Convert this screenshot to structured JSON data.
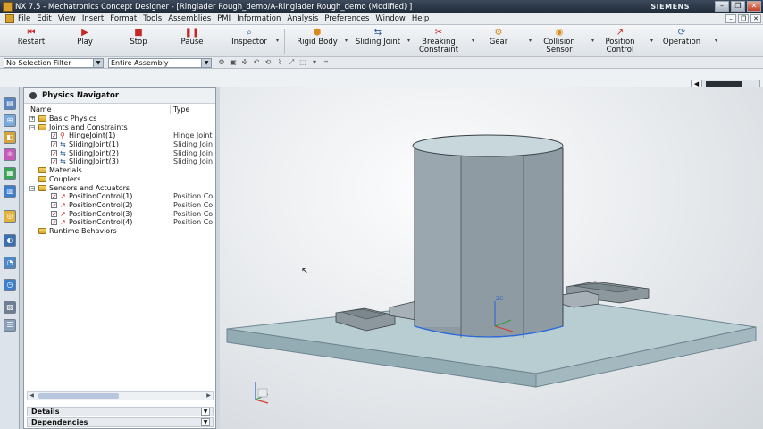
{
  "window": {
    "title": "NX 7.5 - Mechatronics Concept Designer - [Ringlader Rough_demo/A-Ringlader Rough_demo (Modified) ]",
    "brand": "SIEMENS"
  },
  "menu": {
    "items": [
      "File",
      "Edit",
      "View",
      "Insert",
      "Format",
      "Tools",
      "Assemblies",
      "PMI",
      "Information",
      "Analysis",
      "Preferences",
      "Window",
      "Help"
    ]
  },
  "toolbar": {
    "restart": "Restart",
    "play": "Play",
    "stop": "Stop",
    "pause": "Pause",
    "inspector": "Inspector",
    "rigid_body": "Rigid Body",
    "sliding_joint": "Sliding Joint",
    "breaking_constraint_1": "Breaking",
    "breaking_constraint_2": "Constraint",
    "gear": "Gear",
    "collision_sensor_1": "Collision",
    "collision_sensor_2": "Sensor",
    "position_control_1": "Position",
    "position_control_2": "Control",
    "operation": "Operation"
  },
  "selection": {
    "filter": "No Selection Filter",
    "scope": "Entire Assembly"
  },
  "navigator": {
    "title": "Physics Navigator",
    "col_name": "Name",
    "col_type": "Type",
    "basic_physics": "Basic Physics",
    "joints": "Joints and Constraints",
    "hinge1": "HingeJoint(1)",
    "hinge1_type": "Hinge Joint",
    "slide1": "SlidingJoint(1)",
    "slide1_type": "Sliding Joint",
    "slide2": "SlidingJoint(2)",
    "slide2_type": "Sliding Joint",
    "slide3": "SlidingJoint(3)",
    "slide3_type": "Sliding Joint",
    "materials": "Materials",
    "couplers": "Couplers",
    "sensors": "Sensors and Actuators",
    "pc1": "PositionControl(1)",
    "pc1_type": "Position Control",
    "pc2": "PositionControl(2)",
    "pc2_type": "Position Control",
    "pc3": "PositionControl(3)",
    "pc3_type": "Position Control",
    "pc4": "PositionControl(4)",
    "pc4_type": "Position Control",
    "runtime": "Runtime Behaviors",
    "details": "Details",
    "dependencies": "Dependencies"
  },
  "viewport": {
    "triad_z": "ZC"
  },
  "colors": {
    "model_steel": "#8e9ba3",
    "plate": "#b8cdd2",
    "titlebar": "#2a3646"
  }
}
